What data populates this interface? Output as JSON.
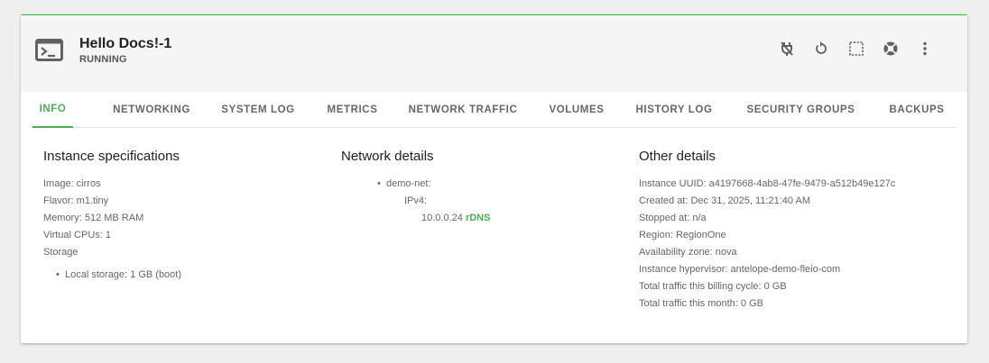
{
  "instance": {
    "name": "Hello Docs!-1",
    "status": "RUNNING"
  },
  "actions": [
    {
      "icon": "power-off-icon"
    },
    {
      "icon": "restart-icon"
    },
    {
      "icon": "resize-icon"
    },
    {
      "icon": "lifebuoy-icon"
    },
    {
      "icon": "more-vert-icon"
    }
  ],
  "tabs": [
    {
      "label": "INFO",
      "active": true
    },
    {
      "label": "NETWORKING"
    },
    {
      "label": "SYSTEM LOG"
    },
    {
      "label": "METRICS"
    },
    {
      "label": "NETWORK TRAFFIC"
    },
    {
      "label": "VOLUMES"
    },
    {
      "label": "HISTORY LOG"
    },
    {
      "label": "SECURITY GROUPS"
    },
    {
      "label": "BACKUPS"
    }
  ],
  "specs": {
    "heading": "Instance specifications",
    "image": "Image: cirros",
    "flavor": "Flavor: m1.tiny",
    "memory": "Memory: 512 MB RAM",
    "vcpus": "Virtual CPUs: 1",
    "storage": "Storage",
    "local_storage": "Local storage: 1 GB (boot)"
  },
  "network": {
    "heading": "Network details",
    "net_name": "demo-net:",
    "ip_version": "IPv4:",
    "ip": "10.0.0.24",
    "rdns": "rDNS"
  },
  "other": {
    "heading": "Other details",
    "uuid": "Instance UUID: a4197668-4ab8-47fe-9479-a512b49e127c",
    "created": "Created at: Dec 31, 2025, 11:21:40 AM",
    "stopped": "Stopped at: n/a",
    "region": "Region: RegionOne",
    "zone": "Availability zone: nova",
    "hypervisor": "Instance hypervisor: antelope-demo-fleio-com",
    "traffic_cycle": "Total traffic this billing cycle: 0 GB",
    "traffic_month": "Total traffic this month: 0 GB"
  },
  "colors": {
    "accent": "#4caf50",
    "icon": "#616161"
  }
}
